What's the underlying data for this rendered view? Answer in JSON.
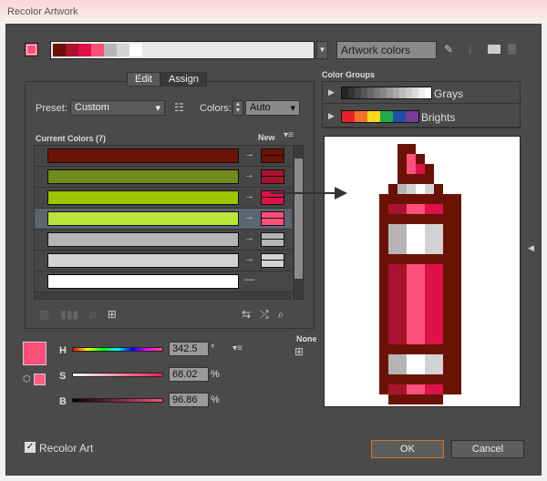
{
  "window": {
    "title": "Recolor Artwork"
  },
  "header": {
    "current_color": "#ff4f7b",
    "harmony_colors": [
      "#6b1206",
      "#a8132e",
      "#dc1247",
      "#ff4f7b",
      "#b5b5b5",
      "#d3d3d3",
      "#ffffff"
    ],
    "group_name": "Artwork colors",
    "icons": [
      "eyedropper-icon",
      "save-group-icon",
      "folder-icon",
      "trash-icon"
    ]
  },
  "tabs": [
    {
      "label": "Edit"
    },
    {
      "label": "Assign"
    }
  ],
  "assign": {
    "preset_label": "Preset:",
    "preset_value": "Custom",
    "colors_label": "Colors:",
    "colors_value": "Auto",
    "current_colors_header": "Current Colors (7)",
    "new_header": "New",
    "rows": [
      {
        "current": "#6b1206",
        "new": "#6b1206"
      },
      {
        "current": "#758a1c",
        "new": "#a8132e"
      },
      {
        "current": "#9ec400",
        "new": "#dc1247"
      },
      {
        "current": "#b8e63b",
        "new": "#ff4f7b"
      },
      {
        "current": "#b5b5b5",
        "new": "#b5b5b5"
      },
      {
        "current": "#d3d3d3",
        "new": "#d3d3d3"
      },
      {
        "current": "#ffffff",
        "new": null
      }
    ],
    "selected_row": 3
  },
  "hsb": {
    "h_label": "H",
    "h_value": "342.5",
    "h_unit": "°",
    "s_label": "S",
    "s_value": "68.02",
    "s_unit": "%",
    "b_label": "B",
    "b_value": "96.86",
    "b_unit": "%",
    "none_label": "None"
  },
  "color_groups": {
    "title": "Color Groups",
    "groups": [
      {
        "name": "Grays",
        "colors": [
          "#222",
          "#333",
          "#444",
          "#555",
          "#666",
          "#777",
          "#888",
          "#999",
          "#aaa",
          "#bbb",
          "#ccc",
          "#ddd",
          "#eee",
          "#fff"
        ]
      },
      {
        "name": "Brights",
        "colors": [
          "#e8202a",
          "#f2712b",
          "#fbd91a",
          "#1ea94b",
          "#1f4fa6",
          "#7b3a9b"
        ]
      }
    ]
  },
  "footer": {
    "recolor_art_label": "Recolor Art",
    "recolor_art_checked": true,
    "ok_label": "OK",
    "cancel_label": "Cancel"
  }
}
